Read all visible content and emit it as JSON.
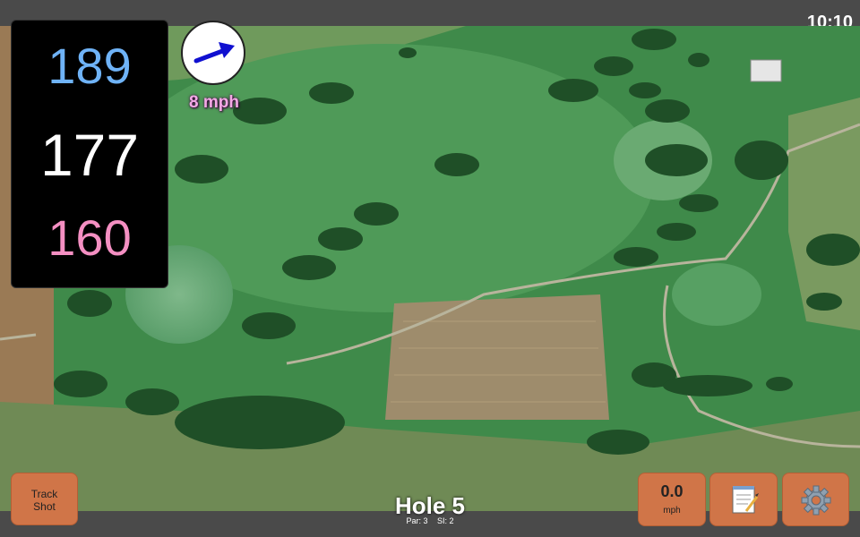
{
  "status_bar": {
    "time": "10:10"
  },
  "distances": {
    "back": "189",
    "center": "177",
    "front": "160"
  },
  "wind": {
    "speed_label": "8 mph",
    "direction_icon": "arrow-icon"
  },
  "buttons": {
    "track_shot_line1": "Track",
    "track_shot_line2": "Shot",
    "speed_value": "0.0",
    "speed_unit": "mph",
    "notes_icon": "notepad-icon",
    "settings_icon": "gear-icon"
  },
  "hole": {
    "title": "Hole 5",
    "par": "Par: 3",
    "si": "SI: 2"
  },
  "colors": {
    "back": "#6fb3f7",
    "center": "#ffffff",
    "front": "#f48fc2",
    "button": "#d07548",
    "wind_label": "#f4a9e6"
  }
}
